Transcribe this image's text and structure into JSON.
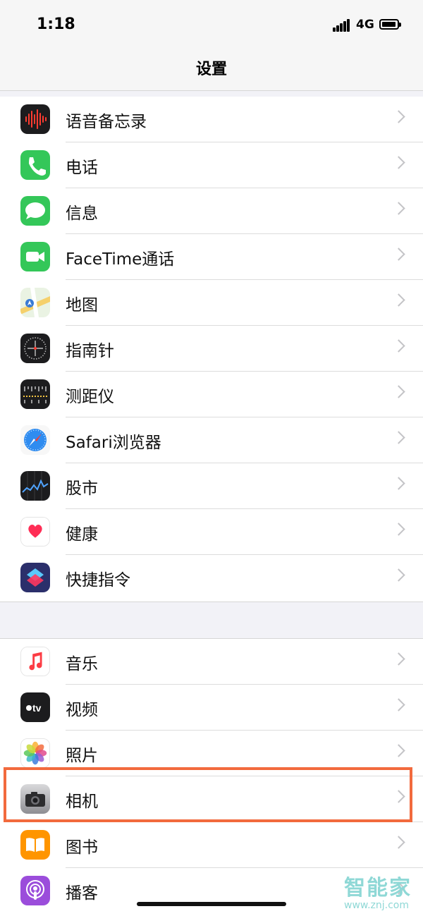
{
  "status_bar": {
    "time": "1:18",
    "network": "4G"
  },
  "nav": {
    "title": "设置"
  },
  "group1": [
    {
      "label": "语音备忘录",
      "icon": "voice-memos-icon"
    },
    {
      "label": "电话",
      "icon": "phone-icon"
    },
    {
      "label": "信息",
      "icon": "messages-icon"
    },
    {
      "label": "FaceTime通话",
      "icon": "facetime-icon"
    },
    {
      "label": "地图",
      "icon": "maps-icon"
    },
    {
      "label": "指南针",
      "icon": "compass-icon"
    },
    {
      "label": "测距仪",
      "icon": "measure-icon"
    },
    {
      "label": "Safari浏览器",
      "icon": "safari-icon"
    },
    {
      "label": "股市",
      "icon": "stocks-icon"
    },
    {
      "label": "健康",
      "icon": "health-icon"
    },
    {
      "label": "快捷指令",
      "icon": "shortcuts-icon"
    }
  ],
  "group2": [
    {
      "label": "音乐",
      "icon": "music-icon"
    },
    {
      "label": "视频",
      "icon": "tv-icon"
    },
    {
      "label": "照片",
      "icon": "photos-icon"
    },
    {
      "label": "相机",
      "icon": "camera-icon",
      "highlighted": true
    },
    {
      "label": "图书",
      "icon": "books-icon"
    },
    {
      "label": "播客",
      "icon": "podcasts-icon"
    }
  ],
  "watermark": {
    "logo": "智能家",
    "url": "www.znj.com"
  },
  "colors": {
    "highlight": "#f26a3d",
    "background": "#f2f2f7"
  }
}
